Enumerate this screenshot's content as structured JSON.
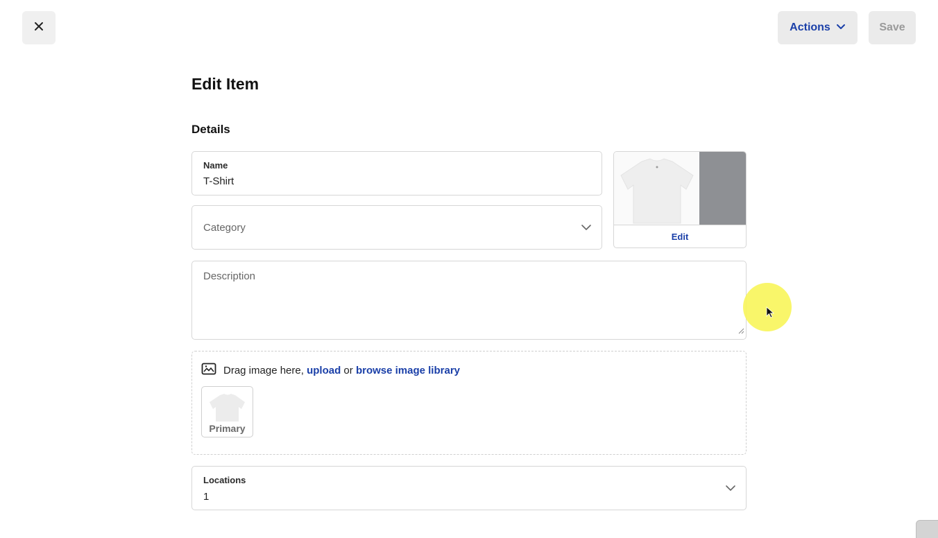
{
  "toolbar": {
    "close_icon": "close-icon",
    "actions_label": "Actions",
    "save_label": "Save"
  },
  "page": {
    "title": "Edit Item",
    "section_title": "Details"
  },
  "form": {
    "name": {
      "label": "Name",
      "value": "T-Shirt"
    },
    "category": {
      "placeholder": "Category",
      "value": ""
    },
    "description": {
      "placeholder": "Description",
      "value": ""
    },
    "locations": {
      "label": "Locations",
      "value": "1"
    }
  },
  "thumbnail": {
    "edit_label": "Edit"
  },
  "image_upload": {
    "prefix": "Drag image here,",
    "upload_link": "upload",
    "or": "or",
    "browse_link": "browse image library",
    "primary_label": "Primary"
  },
  "colors": {
    "accent": "#1a3fa8",
    "button_bg": "#ebebeb",
    "border": "#d6d6d6",
    "cursor_highlight": "#f8f55a"
  }
}
